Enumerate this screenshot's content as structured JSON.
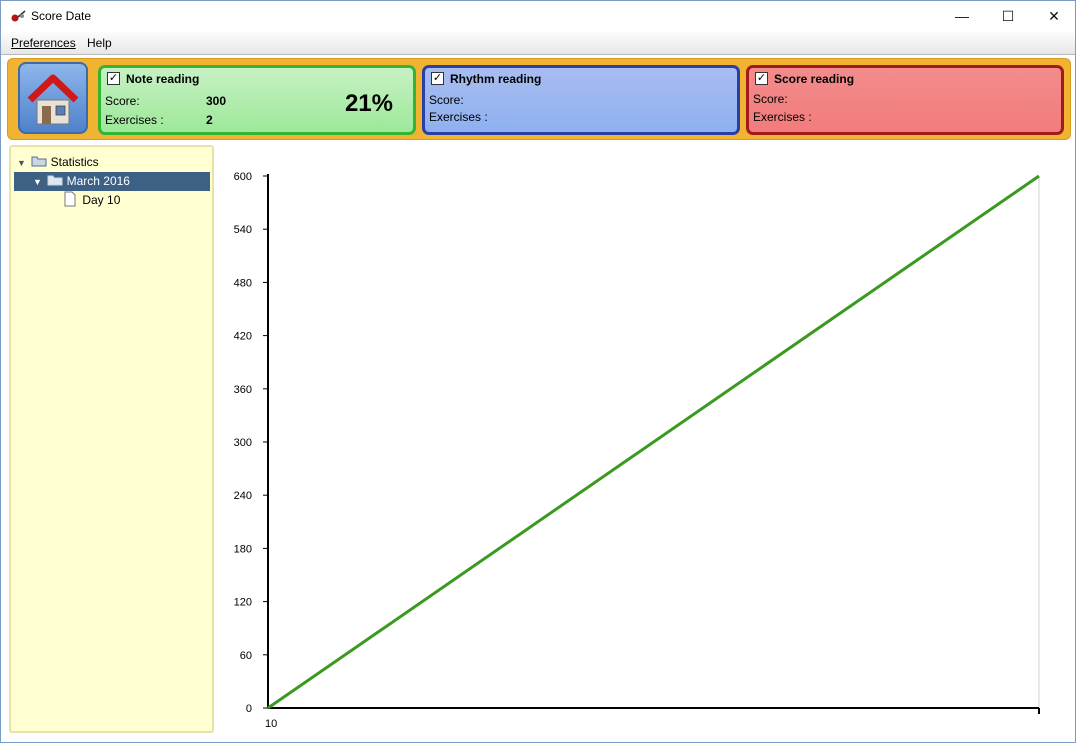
{
  "window": {
    "title": "Score Date",
    "minimize": "—",
    "maximize": "☐",
    "close": "✕"
  },
  "menu": {
    "preferences": "Preferences",
    "help": "Help"
  },
  "panels": {
    "note": {
      "title": "Note reading",
      "checked": "✓",
      "score_label": "Score:",
      "score_value": "300",
      "exercises_label": "Exercises :",
      "exercises_value": "2",
      "percent": "21%"
    },
    "rhythm": {
      "title": "Rhythm reading",
      "checked": "✓",
      "score_label": "Score:",
      "exercises_label": "Exercises :"
    },
    "score": {
      "title": "Score reading",
      "checked": "✓",
      "score_label": "Score:",
      "exercises_label": "Exercises :"
    }
  },
  "tree": {
    "root": "Statistics",
    "month": "March 2016",
    "day": "Day 10",
    "expand_glyph": "▼"
  },
  "colors": {
    "line": "#3a9a1f",
    "accent": "#f0b432"
  },
  "chart_data": {
    "type": "line",
    "x": [
      "10"
    ],
    "series": [
      {
        "values": [
          0,
          600
        ]
      }
    ],
    "ylim": [
      0,
      600
    ],
    "yticks": [
      0,
      60,
      120,
      180,
      240,
      300,
      360,
      420,
      480,
      540,
      600
    ],
    "xlabel": "",
    "ylabel": "",
    "title": ""
  }
}
